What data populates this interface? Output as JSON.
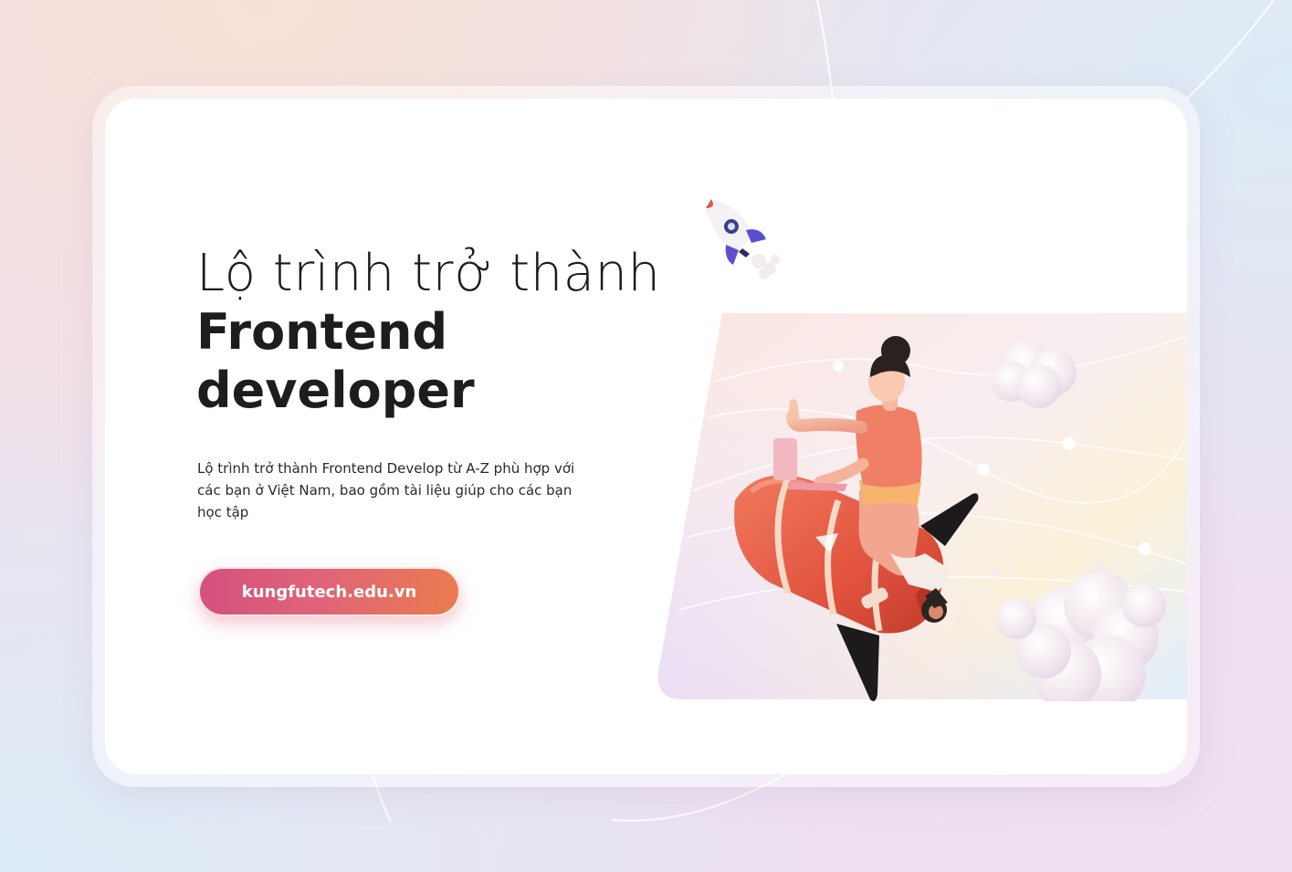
{
  "hero": {
    "title_line1": "Lộ trình trở thành",
    "title_line2": "Frontend",
    "title_line3": "developer",
    "description": "Lộ trình trở thành Frontend Develop từ A-Z phù hợp với các bạn ở Việt Nam, bao gồm tài liệu giúp cho các bạn học tập"
  },
  "cta": {
    "label": "kungfutech.edu.vn"
  },
  "colors": {
    "cta_gradient_start": "#d4517d",
    "cta_gradient_end": "#ea7c4e",
    "title_text": "#1d1d1f",
    "card_background": "#ffffff"
  },
  "icons": {
    "rocket_large": "rocket-icon",
    "rocket_small": "small-rocket-icon",
    "cloud": "cloud-icon",
    "laptop": "laptop-icon"
  }
}
